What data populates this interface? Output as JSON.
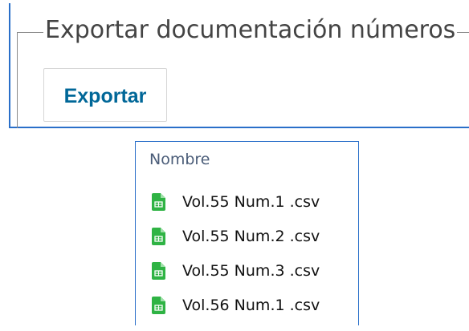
{
  "export_section": {
    "legend": "Exportar documentación números",
    "button_label": "Exportar"
  },
  "file_explorer": {
    "column_header": "Nombre",
    "files": [
      {
        "name": "Vol.55 Num.1 .csv",
        "icon": "csv-file-icon"
      },
      {
        "name": "Vol.55 Num.2 .csv",
        "icon": "csv-file-icon"
      },
      {
        "name": "Vol.55 Num.3 .csv",
        "icon": "csv-file-icon"
      },
      {
        "name": "Vol.56 Num.1 .csv",
        "icon": "csv-file-icon"
      }
    ]
  },
  "colors": {
    "accent_border": "#2a6fc9",
    "button_text": "#006798",
    "csv_icon": "#2fb344"
  }
}
